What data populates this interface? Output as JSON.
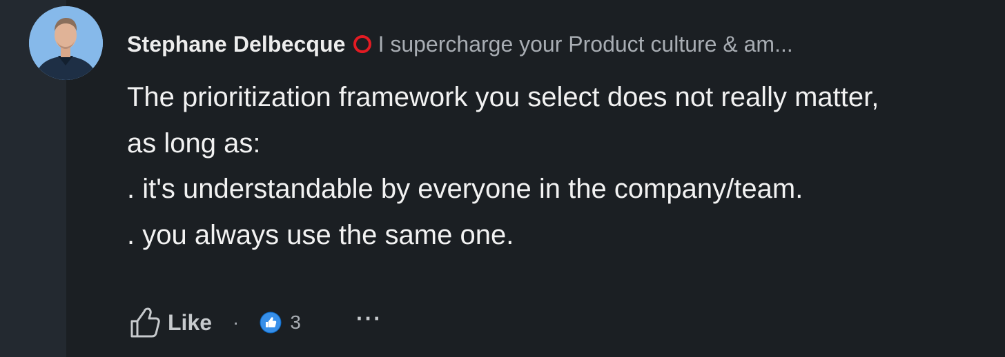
{
  "comment": {
    "author": {
      "name": "Stephane Delbecque",
      "badge_icon": "open-to-work-ring-icon",
      "badge_color": "#e31b23",
      "headline": "I supercharge your Product culture & am..."
    },
    "body": "The prioritization framework you select does not really matter,\nas long as:\n. it's understandable by everyone in the company/team.\n. you always use the same one."
  },
  "actions": {
    "like_label": "Like",
    "separator": "·",
    "reaction_icon": "thumbs-up-reaction-icon",
    "reaction_color": "#378fe9",
    "reaction_count": "3",
    "more_label": "···"
  },
  "colors": {
    "background": "#1b1f23",
    "gutter": "#232930",
    "text_primary": "#f2f2f2",
    "text_secondary": "#a8adb3"
  }
}
